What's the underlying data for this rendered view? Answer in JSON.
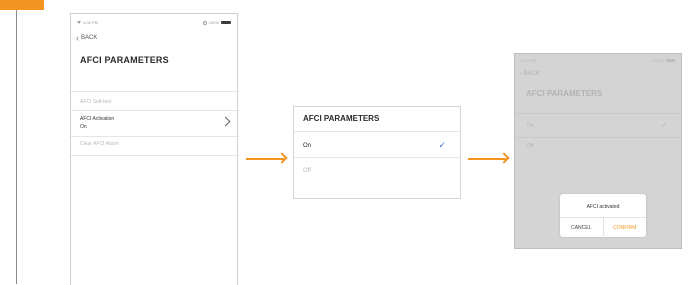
{
  "left_screen": {
    "status_time": "4:04 PM",
    "battery_text": "100%",
    "back_label": "BACK",
    "title": "AFCI PARAMETERS",
    "items": [
      {
        "label": "AFCI Self-test",
        "value": ""
      },
      {
        "label": "AFCI Activation",
        "value": "On"
      },
      {
        "label": "Clear AFCI Alarm",
        "value": ""
      }
    ]
  },
  "center_panel": {
    "title": "AFCI PARAMETERS",
    "options": [
      {
        "label": "On",
        "selected": true
      },
      {
        "label": "Off",
        "selected": false
      }
    ]
  },
  "right_screen": {
    "status_time": "4:04 PM",
    "battery_text": "100%",
    "back_label": "BACK",
    "title": "AFCI PARAMETERS",
    "options": [
      {
        "label": "On",
        "selected": true
      },
      {
        "label": "Off",
        "selected": false
      }
    ],
    "dialog": {
      "message": "AFCI activated",
      "cancel_label": "CANCEL",
      "confirm_label": "CONFIRM"
    }
  },
  "colors": {
    "accent": "#f39422",
    "check": "#3a7bd5"
  },
  "icons": [
    "wifi-icon",
    "alarm-icon",
    "battery-icon",
    "back-chevron-icon",
    "chevron-right-icon",
    "checkmark-icon",
    "arrow-right-icon"
  ]
}
